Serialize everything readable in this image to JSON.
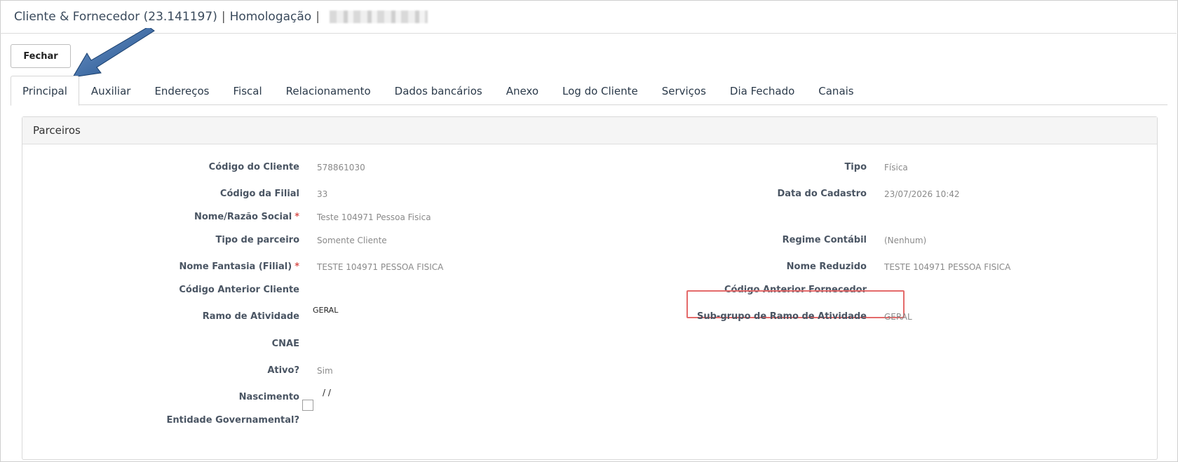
{
  "header": {
    "title": "Cliente & Fornecedor (23.141197)",
    "separator": "|",
    "environment": "Homologação"
  },
  "toolbar": {
    "close_label": "Fechar"
  },
  "tabs": [
    {
      "label": "Principal",
      "active": true
    },
    {
      "label": "Auxiliar"
    },
    {
      "label": "Endereços"
    },
    {
      "label": "Fiscal"
    },
    {
      "label": "Relacionamento"
    },
    {
      "label": "Dados bancários"
    },
    {
      "label": "Anexo"
    },
    {
      "label": "Log do Cliente"
    },
    {
      "label": "Serviços"
    },
    {
      "label": "Dia Fechado"
    },
    {
      "label": "Canais"
    }
  ],
  "panel": {
    "title": "Parceiros",
    "left": {
      "codigo_cliente": {
        "label": "Código do Cliente",
        "value": "578861030"
      },
      "codigo_filial": {
        "label": "Código da Filial",
        "value": "33"
      },
      "nome_razao": {
        "label": "Nome/Razão Social",
        "required": "*",
        "value": "Teste 104971 Pessoa Fisica"
      },
      "tipo_parceiro": {
        "label": "Tipo de parceiro",
        "value": "Somente Cliente"
      },
      "nome_fantasia": {
        "label": "Nome Fantasia (Filial)",
        "required": "*",
        "value": "TESTE 104971 PESSOA FISICA"
      },
      "codigo_anterior_cliente": {
        "label": "Código Anterior Cliente",
        "value": ""
      },
      "ramo_atividade": {
        "label": "Ramo de Atividade",
        "value": "GERAL"
      },
      "cnae": {
        "label": "CNAE",
        "value": ""
      },
      "ativo": {
        "label": "Ativo?",
        "value": "Sim"
      },
      "nascimento": {
        "label": "Nascimento",
        "value": "/ /"
      },
      "entidade_governamental": {
        "label": "Entidade Governamental?",
        "checked": false
      }
    },
    "right": {
      "tipo": {
        "label": "Tipo",
        "value": "Física"
      },
      "data_cadastro": {
        "label": "Data do Cadastro",
        "value": "23/07/2026 10:42"
      },
      "regime_contabil": {
        "label": "Regime Contábil",
        "value": "(Nenhum)"
      },
      "nome_reduzido": {
        "label": "Nome Reduzido",
        "value": "TESTE 104971 PESSOA FISICA"
      },
      "codigo_anterior_fornecedor": {
        "label": "Código Anterior Fornecedor",
        "value": ""
      },
      "subgrupo_ramo": {
        "label": "Sub-grupo de Ramo de Atividade",
        "value": "GERAL"
      }
    }
  },
  "colors": {
    "highlight_border": "#e46a6a",
    "arrow": "#1f4f8a",
    "required": "#d9534f"
  }
}
